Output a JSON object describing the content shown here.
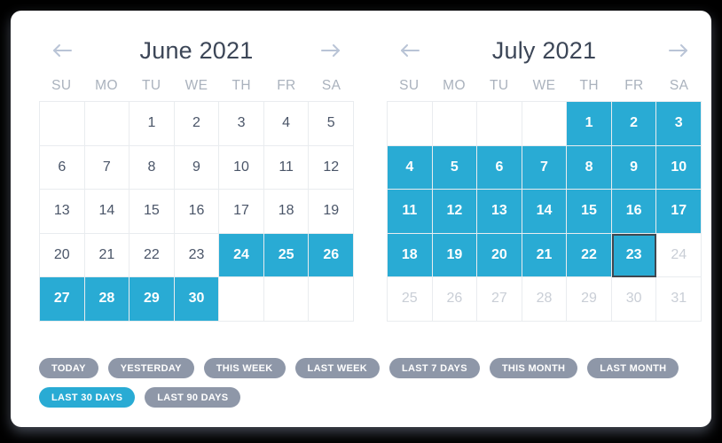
{
  "accent_color": "#29abd4",
  "preset_color": "#8e97a8",
  "today_border_color": "#3f4750",
  "calendars": [
    {
      "name": "june",
      "title": "June 2021",
      "prev_icon": "arrow-left-icon",
      "next_icon": "arrow-right-icon",
      "dow": [
        "SU",
        "MO",
        "TU",
        "WE",
        "TH",
        "FR",
        "SA"
      ],
      "leading_blanks": 2,
      "days": [
        {
          "n": "1",
          "state": "normal"
        },
        {
          "n": "2",
          "state": "normal"
        },
        {
          "n": "3",
          "state": "normal"
        },
        {
          "n": "4",
          "state": "normal"
        },
        {
          "n": "5",
          "state": "normal"
        },
        {
          "n": "6",
          "state": "normal"
        },
        {
          "n": "7",
          "state": "normal"
        },
        {
          "n": "8",
          "state": "normal"
        },
        {
          "n": "9",
          "state": "normal"
        },
        {
          "n": "10",
          "state": "normal"
        },
        {
          "n": "11",
          "state": "normal"
        },
        {
          "n": "12",
          "state": "normal"
        },
        {
          "n": "13",
          "state": "normal"
        },
        {
          "n": "14",
          "state": "normal"
        },
        {
          "n": "15",
          "state": "normal"
        },
        {
          "n": "16",
          "state": "normal"
        },
        {
          "n": "17",
          "state": "normal"
        },
        {
          "n": "18",
          "state": "normal"
        },
        {
          "n": "19",
          "state": "normal"
        },
        {
          "n": "20",
          "state": "normal"
        },
        {
          "n": "21",
          "state": "normal"
        },
        {
          "n": "22",
          "state": "normal"
        },
        {
          "n": "23",
          "state": "normal"
        },
        {
          "n": "24",
          "state": "selected"
        },
        {
          "n": "25",
          "state": "selected"
        },
        {
          "n": "26",
          "state": "selected"
        },
        {
          "n": "27",
          "state": "selected"
        },
        {
          "n": "28",
          "state": "selected"
        },
        {
          "n": "29",
          "state": "selected"
        },
        {
          "n": "30",
          "state": "selected"
        }
      ],
      "trailing_blanks": 3
    },
    {
      "name": "july",
      "title": "July 2021",
      "prev_icon": "arrow-left-icon",
      "next_icon": "arrow-right-icon",
      "dow": [
        "SU",
        "MO",
        "TU",
        "WE",
        "TH",
        "FR",
        "SA"
      ],
      "leading_blanks": 4,
      "days": [
        {
          "n": "1",
          "state": "selected"
        },
        {
          "n": "2",
          "state": "selected"
        },
        {
          "n": "3",
          "state": "selected"
        },
        {
          "n": "4",
          "state": "selected"
        },
        {
          "n": "5",
          "state": "selected"
        },
        {
          "n": "6",
          "state": "selected"
        },
        {
          "n": "7",
          "state": "selected"
        },
        {
          "n": "8",
          "state": "selected"
        },
        {
          "n": "9",
          "state": "selected"
        },
        {
          "n": "10",
          "state": "selected"
        },
        {
          "n": "11",
          "state": "selected"
        },
        {
          "n": "12",
          "state": "selected"
        },
        {
          "n": "13",
          "state": "selected"
        },
        {
          "n": "14",
          "state": "selected"
        },
        {
          "n": "15",
          "state": "selected"
        },
        {
          "n": "16",
          "state": "selected"
        },
        {
          "n": "17",
          "state": "selected"
        },
        {
          "n": "18",
          "state": "selected"
        },
        {
          "n": "19",
          "state": "selected"
        },
        {
          "n": "20",
          "state": "selected"
        },
        {
          "n": "21",
          "state": "selected"
        },
        {
          "n": "22",
          "state": "selected"
        },
        {
          "n": "23",
          "state": "selected today"
        },
        {
          "n": "24",
          "state": "disabled"
        },
        {
          "n": "25",
          "state": "disabled"
        },
        {
          "n": "26",
          "state": "disabled"
        },
        {
          "n": "27",
          "state": "disabled"
        },
        {
          "n": "28",
          "state": "disabled"
        },
        {
          "n": "29",
          "state": "disabled"
        },
        {
          "n": "30",
          "state": "disabled"
        },
        {
          "n": "31",
          "state": "disabled"
        }
      ],
      "trailing_blanks": 0
    }
  ],
  "presets": [
    {
      "label": "TODAY",
      "active": false
    },
    {
      "label": "YESTERDAY",
      "active": false
    },
    {
      "label": "THIS WEEK",
      "active": false
    },
    {
      "label": "LAST WEEK",
      "active": false
    },
    {
      "label": "LAST 7 DAYS",
      "active": false
    },
    {
      "label": "THIS MONTH",
      "active": false
    },
    {
      "label": "LAST MONTH",
      "active": false
    },
    {
      "label": "LAST 30 DAYS",
      "active": true
    },
    {
      "label": "LAST 90 DAYS",
      "active": false
    }
  ]
}
